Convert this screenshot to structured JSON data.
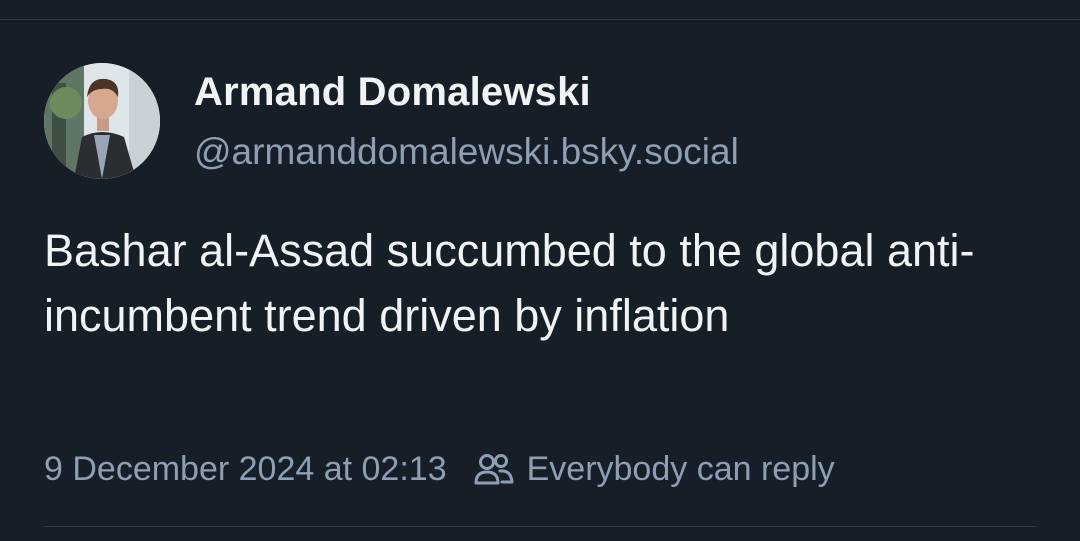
{
  "post": {
    "author": {
      "display_name": "Armand Domalewski",
      "handle": "@armanddomalewski.bsky.social",
      "avatar_icon": "profile-photo"
    },
    "text": "Bashar al-Assad succumbed to the global anti-incumbent trend driven by inflation",
    "timestamp": "9 December 2024 at 02:13",
    "reply_setting": {
      "icon": "people-icon",
      "label": "Everybody can reply"
    }
  },
  "colors": {
    "background": "#161e27",
    "primary_text": "#f1f3f5",
    "secondary_text": "#8d9fb3",
    "divider": "#2e3a47"
  }
}
